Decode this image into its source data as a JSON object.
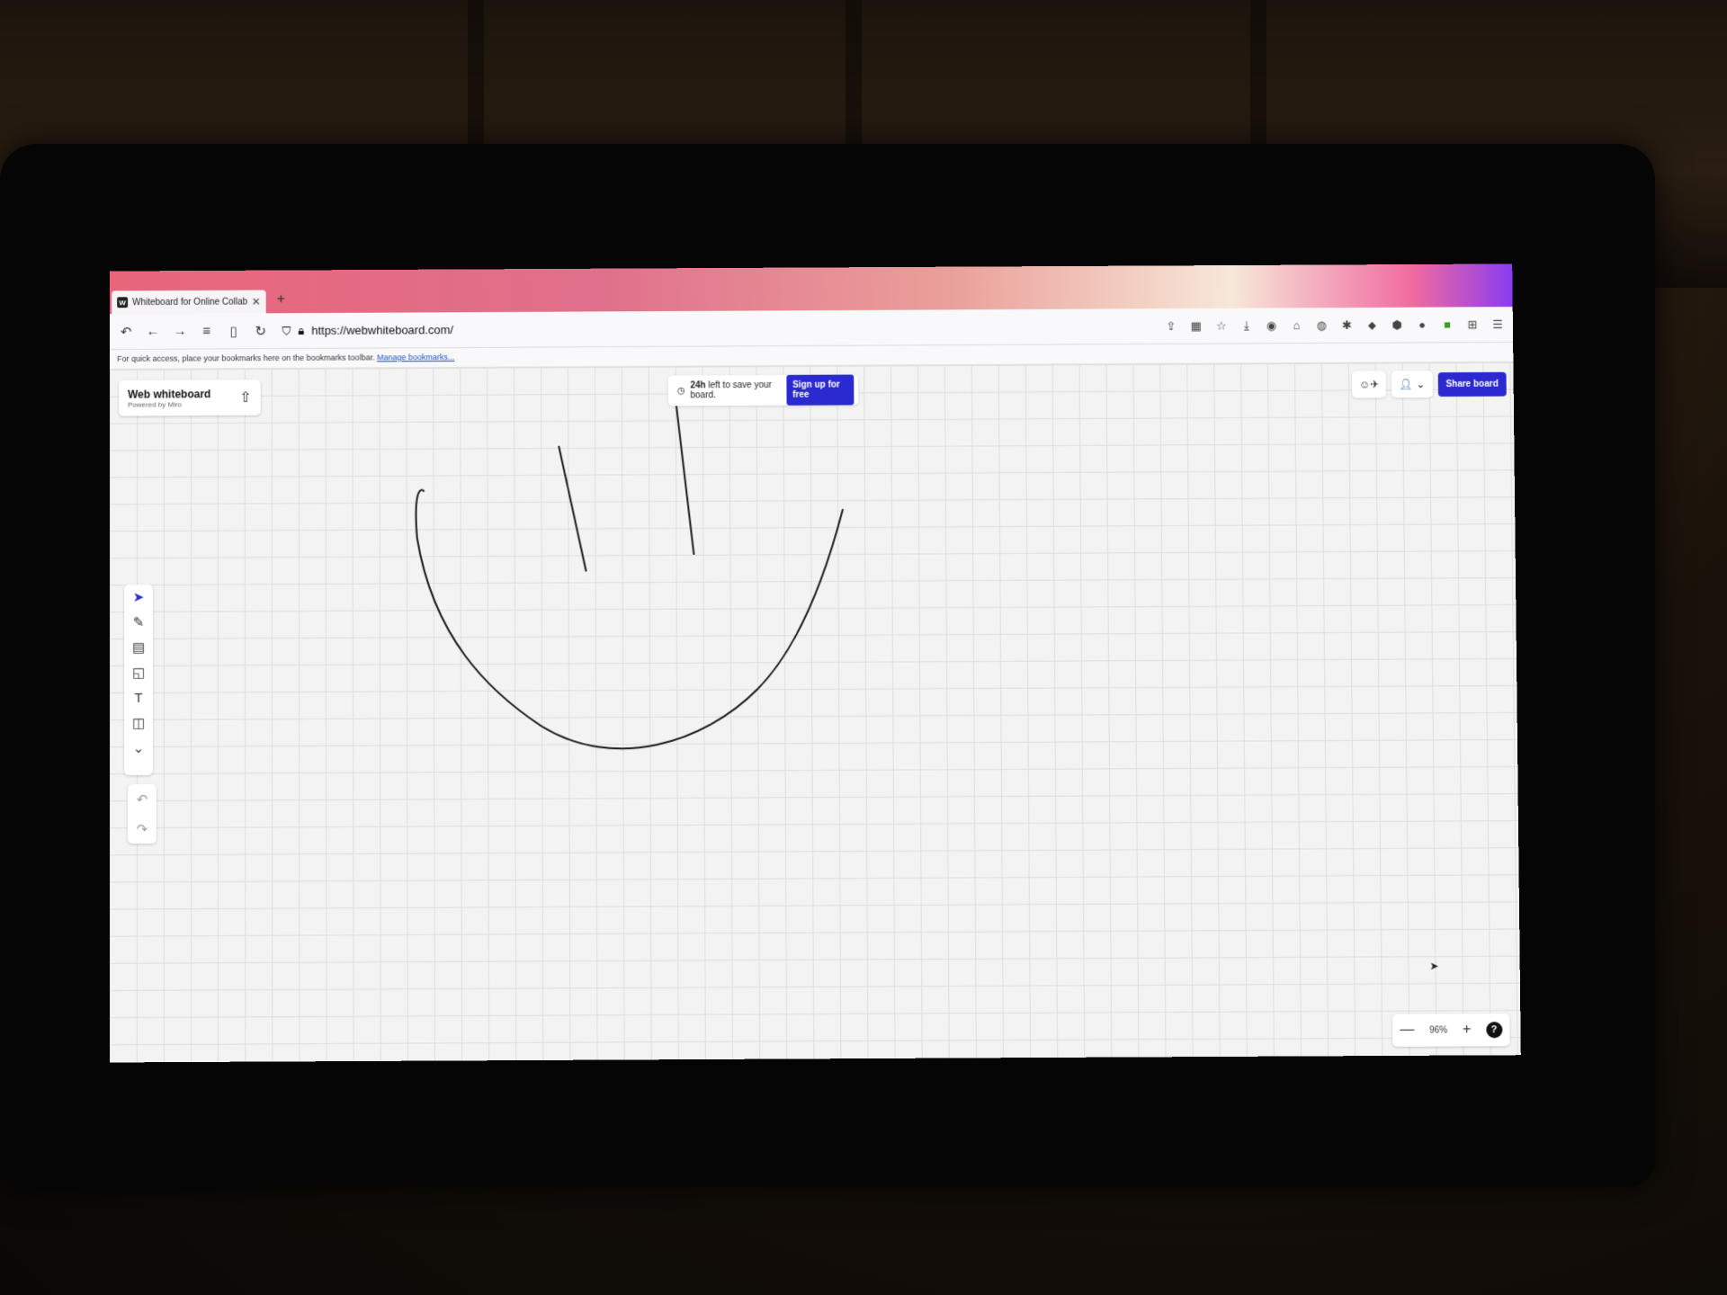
{
  "browser": {
    "tab_title": "Whiteboard for Online Collabora",
    "tab_favicon": "W",
    "new_tab": "+",
    "url": "https://webwhiteboard.com/",
    "bookmarks_text": "For quick access, place your bookmarks here on the bookmarks toolbar.",
    "bookmarks_link": "Manage bookmarks..."
  },
  "board": {
    "brand_title": "Web whiteboard",
    "brand_subtitle": "Powered by Miro",
    "banner_time": "24h",
    "banner_text": "left to save your board.",
    "signup_label": "Sign up for free",
    "share_label": "Share board",
    "zoom_level": "96%",
    "zoom_out": "—",
    "zoom_in": "+",
    "help": "?",
    "tools": [
      {
        "name": "select-tool",
        "icon": "cursor-icon",
        "active": true
      },
      {
        "name": "pen-tool",
        "icon": "pen-icon"
      },
      {
        "name": "template-tool",
        "icon": "template-icon"
      },
      {
        "name": "sticky-note-tool",
        "icon": "sticky-note-icon"
      },
      {
        "name": "text-tool",
        "icon": "text-icon"
      },
      {
        "name": "shapes-tool",
        "icon": "shapes-icon"
      },
      {
        "name": "more-tools",
        "icon": "double-chevron-down-icon"
      }
    ]
  },
  "colors": {
    "accent": "#2a2ad0",
    "tabbar_gradient": [
      "#e8657a",
      "#eaa09a",
      "#8a3cf0"
    ]
  }
}
